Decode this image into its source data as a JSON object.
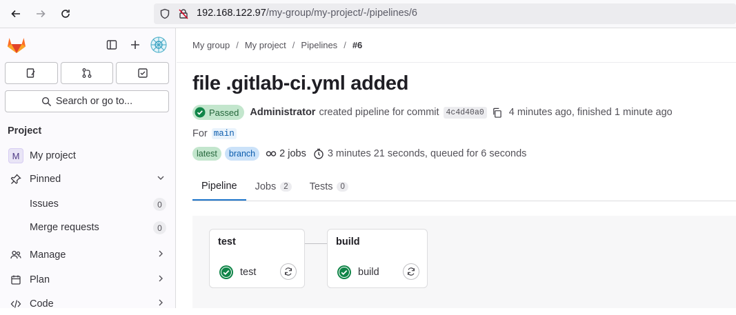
{
  "browser": {
    "url_host": "192.168.122.97",
    "url_path": "/my-group/my-project/-/pipelines/6"
  },
  "sidebar": {
    "search_label": "Search or go to...",
    "section_title": "Project",
    "project_initial": "M",
    "project_name": "My project",
    "pinned_label": "Pinned",
    "pinned_items": [
      {
        "label": "Issues",
        "count": "0"
      },
      {
        "label": "Merge requests",
        "count": "0"
      }
    ],
    "groups": [
      {
        "label": "Manage",
        "icon": "users-icon"
      },
      {
        "label": "Plan",
        "icon": "calendar-icon"
      },
      {
        "label": "Code",
        "icon": "code-icon"
      }
    ]
  },
  "breadcrumb": [
    "My group",
    "My project",
    "Pipelines",
    "#6"
  ],
  "pipeline": {
    "title": "file .gitlab-ci.yml added",
    "status": "Passed",
    "author": "Administrator",
    "created_text": "created pipeline for commit",
    "commit_sha": "4c4d40a0",
    "time_text": "4 minutes ago, finished 1 minute ago",
    "for_label": "For",
    "ref": "main",
    "tags": [
      "latest",
      "branch"
    ],
    "jobs_count_text": "2 jobs",
    "duration_text": "3 minutes 21 seconds, queued for 6 seconds"
  },
  "tabs": [
    {
      "label": "Pipeline",
      "count": null
    },
    {
      "label": "Jobs",
      "count": "2"
    },
    {
      "label": "Tests",
      "count": "0"
    }
  ],
  "stages": [
    {
      "title": "test",
      "job": "test",
      "status": "success"
    },
    {
      "title": "build",
      "job": "build",
      "status": "success"
    }
  ],
  "colors": {
    "accent": "#1f75cb",
    "success": "#108548",
    "gitlab_orange": "#fc6d26"
  }
}
